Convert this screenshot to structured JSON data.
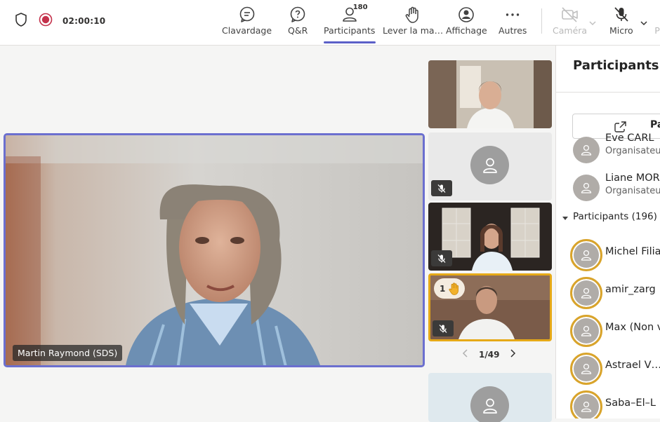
{
  "topbar": {
    "timer": "02:00:10",
    "buttons": [
      {
        "label": "Clavardage",
        "icon": "chat-icon"
      },
      {
        "label": "Q&R",
        "icon": "qna-icon"
      },
      {
        "label": "Participants",
        "icon": "people-icon",
        "count": "180",
        "active": true
      },
      {
        "label": "Lever la ma…",
        "icon": "raise-hand-icon"
      },
      {
        "label": "Affichage",
        "icon": "view-icon"
      },
      {
        "label": "Autres",
        "icon": "more-icon"
      },
      {
        "label": "Caméra",
        "icon": "camera-off-icon",
        "disabled": true
      },
      {
        "label": "Micro",
        "icon": "mic-off-icon"
      },
      {
        "label": "P",
        "icon": "share-icon"
      }
    ]
  },
  "stage": {
    "main_speaker": "Martin Raymond (SDS)",
    "hand_count": "1",
    "pager": "1/49"
  },
  "panel": {
    "title": "Participants",
    "share_label": "Parta",
    "organizers": [
      {
        "name": "Eve CARL",
        "role": "Organisateu"
      },
      {
        "name": "Liane MOR",
        "role": "Organisateu"
      }
    ],
    "section_label": "Participants (196)",
    "attendees": [
      {
        "name": "Michel Filia"
      },
      {
        "name": "amir_zarg"
      },
      {
        "name": "Max (Non v"
      },
      {
        "name": "Astrael V…"
      },
      {
        "name": "Saba–El–L"
      }
    ]
  },
  "colors": {
    "accent": "#5b5fc7",
    "hand_raised_ring": "#d9a42b",
    "recording": "#c4314b"
  }
}
